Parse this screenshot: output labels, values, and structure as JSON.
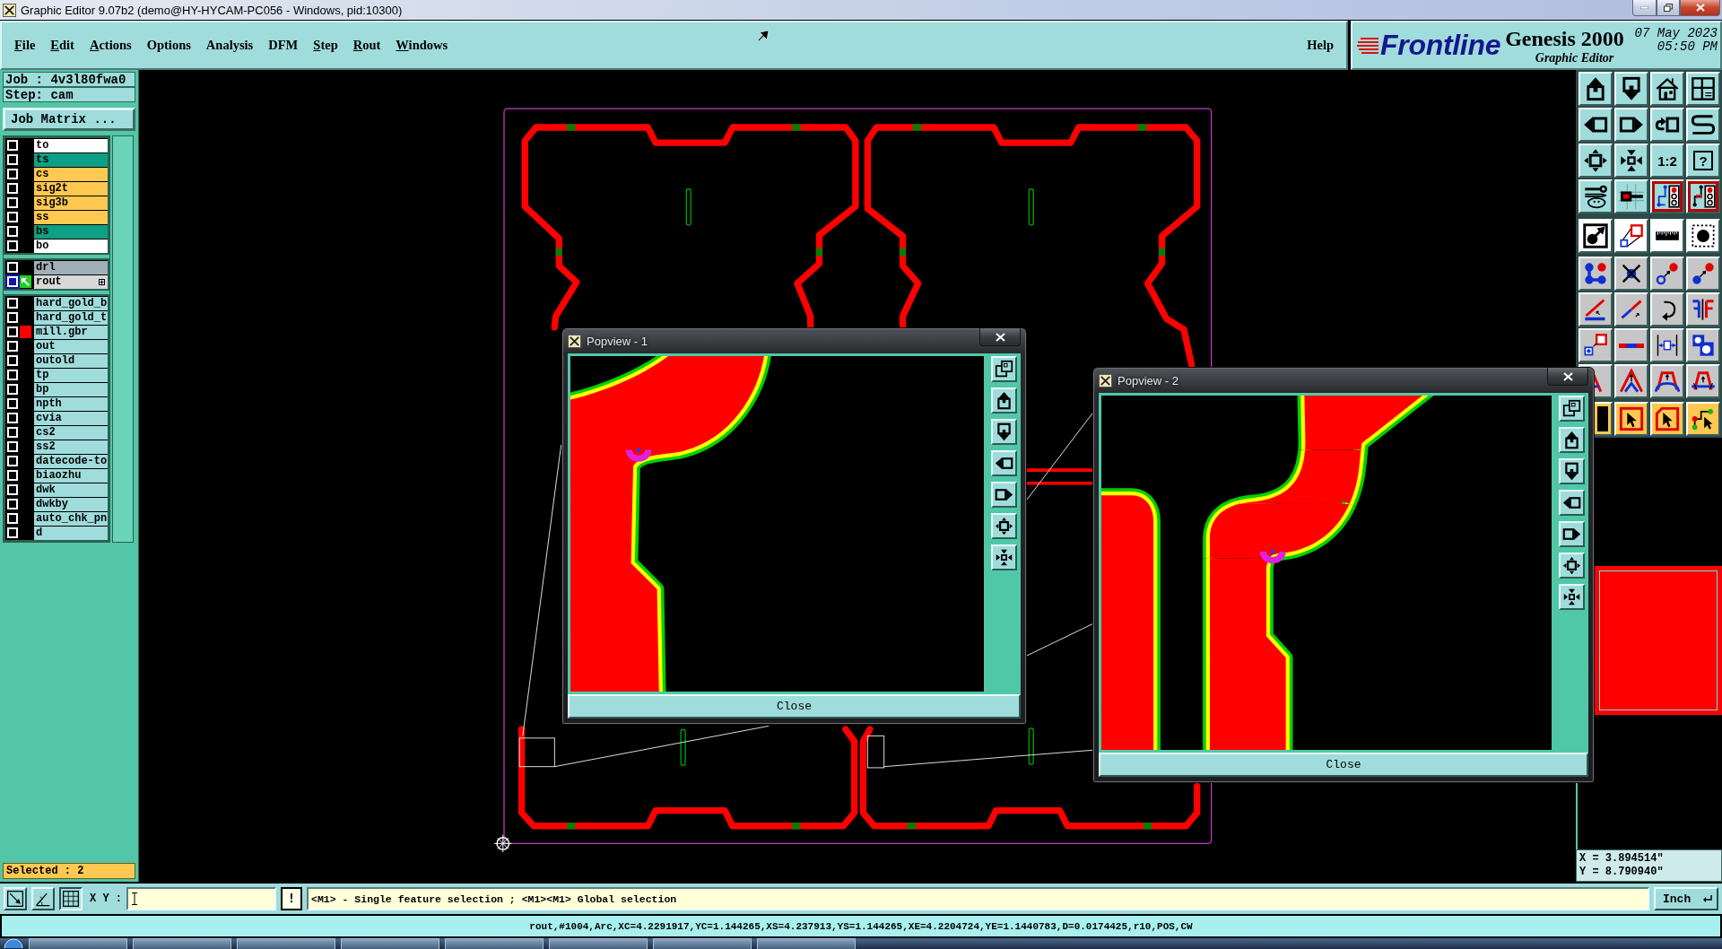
{
  "window": {
    "title": "Graphic Editor 9.07b2 (demo@HY-HYCAM-PC056 - Windows, pid:10300)"
  },
  "menu": {
    "items": [
      {
        "label": "File",
        "mnemonic": true
      },
      {
        "label": "Edit",
        "mnemonic": true
      },
      {
        "label": "Actions",
        "mnemonic": true
      },
      {
        "label": "Options",
        "mnemonic": false
      },
      {
        "label": "Analysis",
        "mnemonic": false
      },
      {
        "label": "DFM",
        "mnemonic": false
      },
      {
        "label": "Step",
        "mnemonic": true
      },
      {
        "label": "Rout",
        "mnemonic": true
      },
      {
        "label": "Windows",
        "mnemonic": true
      }
    ],
    "help": {
      "label": "Help",
      "mnemonic": false
    }
  },
  "branding": {
    "logo": "Frontline",
    "product": "Genesis 2000",
    "module": "Graphic Editor",
    "date": "07 May 2023",
    "time": "05:50 PM"
  },
  "job_panel": {
    "job": "Job : 4v3l80fwa0",
    "step": "Step: cam",
    "matrix_button": "Job Matrix ...",
    "layer_groups": [
      {
        "layers": [
          {
            "name": "to",
            "color": "#ffffff",
            "affected": false,
            "work_layer": false
          },
          {
            "name": "ts",
            "color": "#0ea084",
            "affected": false,
            "work_layer": false
          },
          {
            "name": "cs",
            "color": "#ffc850",
            "affected": false,
            "work_layer": false
          },
          {
            "name": "sig2t",
            "color": "#ffc850",
            "affected": false,
            "work_layer": false
          },
          {
            "name": "sig3b",
            "color": "#ffc850",
            "affected": false,
            "work_layer": false
          },
          {
            "name": "ss",
            "color": "#ffc850",
            "affected": false,
            "work_layer": false
          },
          {
            "name": "bs",
            "color": "#0ea084",
            "affected": false,
            "work_layer": false
          },
          {
            "name": "bo",
            "color": "#ffffff",
            "affected": false,
            "work_layer": false
          }
        ]
      },
      {
        "layers": [
          {
            "name": "drl",
            "color": "#a0b0b8",
            "affected": false,
            "work_layer": false
          },
          {
            "name": "rout",
            "color": "#d8d8d8",
            "affected": true,
            "work_layer": true
          }
        ]
      },
      {
        "layers": [
          {
            "name": "hard_gold_b",
            "color": "#a0dcdc",
            "affected": false,
            "work_layer": false
          },
          {
            "name": "hard_gold_t",
            "color": "#a0dcdc",
            "affected": false,
            "work_layer": false
          },
          {
            "name": "mill.gbr",
            "color": "#a0dcdc",
            "affected": false,
            "work_layer": false,
            "swatch": {
              "color": "#ff0000"
            }
          },
          {
            "name": "out",
            "color": "#a0dcdc",
            "affected": false,
            "work_layer": false
          },
          {
            "name": "outold",
            "color": "#a0dcdc",
            "affected": false,
            "work_layer": false
          },
          {
            "name": "tp",
            "color": "#a0dcdc",
            "affected": false,
            "work_layer": false
          },
          {
            "name": "bp",
            "color": "#a0dcdc",
            "affected": false,
            "work_layer": false
          },
          {
            "name": "npth",
            "color": "#a0dcdc",
            "affected": false,
            "work_layer": false
          },
          {
            "name": "cvia",
            "color": "#a0dcdc",
            "affected": false,
            "work_layer": false
          },
          {
            "name": "cs2",
            "color": "#a0dcdc",
            "affected": false,
            "work_layer": false
          },
          {
            "name": "ss2",
            "color": "#a0dcdc",
            "affected": false,
            "work_layer": false
          },
          {
            "name": "datecode-to",
            "color": "#a0dcdc",
            "affected": false,
            "work_layer": false
          },
          {
            "name": "biaozhu",
            "color": "#a0dcdc",
            "affected": false,
            "work_layer": false
          },
          {
            "name": "dwk",
            "color": "#a0dcdc",
            "affected": false,
            "work_layer": false
          },
          {
            "name": "dwkby",
            "color": "#a0dcdc",
            "affected": false,
            "work_layer": false
          },
          {
            "name": "auto_chk_pn",
            "color": "#a0dcdc",
            "affected": false,
            "work_layer": false
          },
          {
            "name": "d",
            "color": "#a0dcdc",
            "affected": false,
            "work_layer": false
          }
        ]
      }
    ],
    "selected": "Selected : 2"
  },
  "toolbar": {
    "sections": [
      {
        "kind": "view",
        "buttons": [
          {
            "kind": "page_up",
            "on": false
          },
          {
            "kind": "page_down",
            "on": false
          },
          {
            "kind": "home",
            "on": false
          },
          {
            "kind": "grid_xy",
            "on": false
          },
          {
            "kind": "pan_left",
            "on": false
          },
          {
            "kind": "pan_right",
            "on": false
          },
          {
            "kind": "undo_box",
            "on": false
          },
          {
            "kind": "snake",
            "on": false
          },
          {
            "kind": "zoom_out_box",
            "on": false
          },
          {
            "kind": "zoom_in_box",
            "on": false
          },
          {
            "kind": "ratio",
            "label": "1:2",
            "on": false
          },
          {
            "kind": "query",
            "label": "?",
            "on": false
          },
          {
            "kind": "tools",
            "on": false
          },
          {
            "kind": "snap_pad",
            "on": false
          },
          {
            "kind": "netlist",
            "on": true
          },
          {
            "kind": "netlist_alt",
            "on": true
          }
        ]
      },
      {
        "kind": "measure",
        "buttons": [
          {
            "kind": "pad_arrow",
            "on": false
          },
          {
            "kind": "transform",
            "on": false
          },
          {
            "kind": "ruler",
            "on": false
          },
          {
            "kind": "pad_dashed",
            "on": false
          }
        ]
      },
      {
        "kind": "edit",
        "buttons": [
          {
            "kind": "connect",
            "on": false
          },
          {
            "kind": "cross",
            "on": false
          },
          {
            "kind": "move_hollow",
            "on": false
          },
          {
            "kind": "move_solid",
            "on": false
          },
          {
            "kind": "angle_line",
            "on": false
          },
          {
            "kind": "line_color",
            "on": false
          },
          {
            "kind": "rotate",
            "on": false
          },
          {
            "kind": "mirror",
            "on": false
          },
          {
            "kind": "resize_pad",
            "on": false
          },
          {
            "kind": "line_split",
            "on": false
          },
          {
            "kind": "spacing",
            "on": false
          },
          {
            "kind": "shapes",
            "on": false
          },
          {
            "kind": "peak_partial",
            "on": false
          },
          {
            "kind": "peak_double",
            "on": false
          },
          {
            "kind": "arch",
            "on": false
          },
          {
            "kind": "arch_cross",
            "on": false
          }
        ]
      },
      {
        "kind": "select",
        "buttons": [
          {
            "kind": "black_box",
            "on": false
          },
          {
            "kind": "select_arrow",
            "on": false
          },
          {
            "kind": "select_octagon",
            "on": false
          },
          {
            "kind": "select_net",
            "on": false
          }
        ]
      }
    ]
  },
  "popviews": [
    {
      "title": "Popview - 1",
      "close_button": "Close"
    },
    {
      "title": "Popview - 2",
      "close_button": "Close"
    }
  ],
  "coordinates": {
    "x": "X = 3.894514\"",
    "y": "Y = 8.790940\""
  },
  "command_bar": {
    "tools": [
      {
        "kind": "snap",
        "on": false
      },
      {
        "kind": "angle",
        "on": false
      },
      {
        "kind": "grid",
        "on": true
      }
    ],
    "xy_label": "X Y :",
    "alert_button": "!",
    "message": "<M1> - Single feature selection ; <M1><M1> Global selection",
    "units": "Inch"
  },
  "status_bar": {
    "text": "rout,#1004,Arc,XC=4.2291917,YC=1.144265,XS=4.237913,YS=1.144265,XE=4.2204724,YE=1.1440783,D=0.0174425,r10,POS,CW"
  }
}
